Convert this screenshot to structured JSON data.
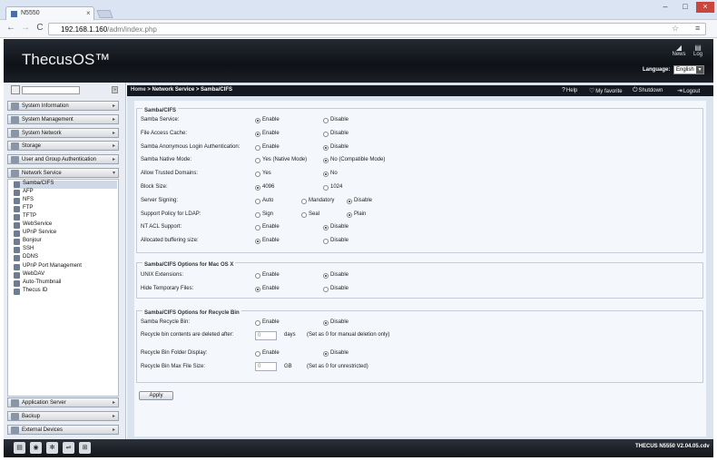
{
  "browser": {
    "tab_title": "N5550",
    "url_host": "192.168.1.160",
    "url_path": "/adm/index.php",
    "window_controls": [
      "–",
      "□",
      "×"
    ],
    "nav": {
      "back": "←",
      "forward": "→",
      "reload": "C"
    }
  },
  "header": {
    "logo": "ThecusOS™",
    "news_label": "News",
    "log_label": "Log",
    "language_label": "Language:",
    "language_value": "English"
  },
  "topbar": {
    "breadcrumb_home": "Home",
    "breadcrumb_rest": " > Network Service > Samba/CIFS",
    "help": "Help",
    "my_favorite": "My favorite",
    "shutdown": "Shutdown",
    "logout": "Logout"
  },
  "sidebar": {
    "categories_top": [
      "System Information",
      "System Management",
      "System Network",
      "Storage",
      "User and Group Authentication",
      "Network Service"
    ],
    "network_items": [
      "Samba/CIFS",
      "AFP",
      "NFS",
      "FTP",
      "TFTP",
      "WebService",
      "UPnP Service",
      "Bonjour",
      "SSH",
      "DDNS",
      "UPnP Port Management",
      "WebDAV",
      "Auto-Thumbnail",
      "Thecus ID"
    ],
    "categories_bottom": [
      "Application Server",
      "Backup",
      "External Devices"
    ]
  },
  "samba": {
    "legend": "Samba/CIFS",
    "rows": [
      {
        "label": "Samba Service:",
        "opt1": "Enable",
        "opt2": "Disable",
        "selected": 1
      },
      {
        "label": "File Access Cache:",
        "opt1": "Enable",
        "opt2": "Disable",
        "selected": 1
      },
      {
        "label": "Samba Anonymous Login Authentication:",
        "opt1": "Enable",
        "opt2": "Disable",
        "selected": 2
      },
      {
        "label": "Samba Native Mode:",
        "opt1": "Yes (Native Mode)",
        "opt2": "No (Compatible Mode)",
        "selected": 2
      },
      {
        "label": "Allow Trusted Domains:",
        "opt1": "Yes",
        "opt2": "No",
        "selected": 2
      },
      {
        "label": "Block Size:",
        "opt1": "4096",
        "opt2": "1024",
        "selected": 1
      },
      {
        "label": "Server Signing:",
        "opt1": "Auto",
        "opt2": "Mandatory",
        "opt3": "Disable",
        "selected": 3
      },
      {
        "label": "Support Policy for LDAP:",
        "opt1": "Sign",
        "opt2": "Seal",
        "opt3": "Plain",
        "selected": 3
      },
      {
        "label": "NT ACL Support:",
        "opt1": "Enable",
        "opt2": "Disable",
        "selected": 2
      },
      {
        "label": "Allocated buffering size:",
        "opt1": "Enable",
        "opt2": "Disable",
        "selected": 1
      }
    ]
  },
  "macos": {
    "legend": "Samba/CIFS Options for Mac OS X",
    "rows": [
      {
        "label": "UNIX Extensions:",
        "opt1": "Enable",
        "opt2": "Disable",
        "selected": 2
      },
      {
        "label": "Hide Temporary Files:",
        "opt1": "Enable",
        "opt2": "Disable",
        "selected": 1
      }
    ]
  },
  "recycle": {
    "legend": "Samba/CIFS Options for Recycle Bin",
    "bin_label": "Samba Recycle Bin:",
    "bin_opt1": "Enable",
    "bin_opt2": "Disable",
    "days_label": "Recycle bin contents are deleted after:",
    "days_value": "0",
    "days_unit": "days",
    "days_note": "(Set as 0 for manual deletion only)",
    "display_label": "Recycle Bin Folder Display:",
    "display_opt1": "Enable",
    "display_opt2": "Disable",
    "maxsize_label": "Recycle Bin Max File Size:",
    "maxsize_value": "0",
    "maxsize_unit": "GB",
    "maxsize_note": "(Set as 0 for unrestricted)"
  },
  "apply_label": "Apply",
  "footer_version": "THECUS N5550  V2.04.05.cdv"
}
